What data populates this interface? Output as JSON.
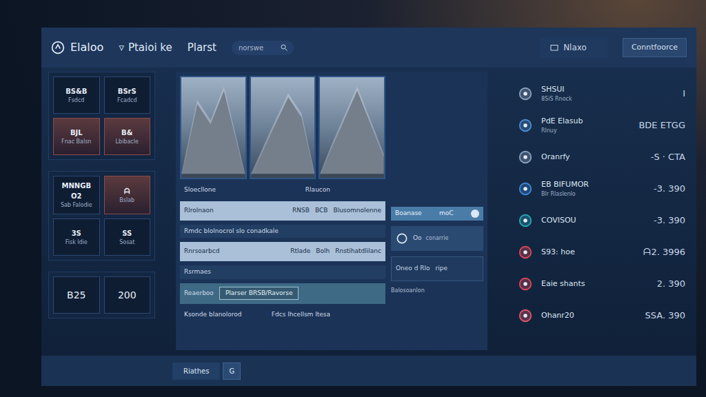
{
  "header": {
    "logo": "Elaloo",
    "menu_icon": "▿",
    "menu": "Ptaioi ke",
    "nav": "Plarst",
    "search": {
      "placeholder": "norswe"
    },
    "user": "Nlaxo",
    "action": "Conntfoorce"
  },
  "sidebar": {
    "groups": [
      {
        "tiles": [
          {
            "title": "BS&B",
            "sub": "Fsdcd",
            "highlighted": false
          },
          {
            "title": "BSrS",
            "sub": "Fcadcd",
            "highlighted": false
          },
          {
            "title": "BJL",
            "sub": "Fnac Balsn",
            "highlighted": true
          },
          {
            "title": "B&",
            "sub": "Lbibacle",
            "highlighted": true
          }
        ]
      },
      {
        "tiles": [
          {
            "title": "MNNGB O2",
            "sub": "Sab Falodie",
            "highlighted": false
          },
          {
            "title": "ᗩ",
            "sub": "Bslab",
            "highlighted": true
          },
          {
            "title": "3S",
            "sub": "Fisk ldie",
            "highlighted": false
          },
          {
            "title": "SS",
            "sub": "Sosat",
            "highlighted": false
          }
        ]
      }
    ],
    "totals": [
      "B25",
      "200"
    ]
  },
  "form": {
    "rows": [
      {
        "kind": "head",
        "cells": [
          "Sloecllone",
          "Rlaucon"
        ]
      },
      {
        "kind": "field",
        "cells": [
          "Rlrolnaon",
          "RNSB",
          "BCB",
          "Blusomnolenne"
        ]
      },
      {
        "kind": "label",
        "cells": [
          "Rmdc blolnocrol slo conadkale"
        ]
      },
      {
        "kind": "field",
        "cells": [
          "Rnrsoarbcd",
          "Rtlade",
          "Bolh",
          "Rnstihatdlilanc"
        ]
      },
      {
        "kind": "label",
        "cells": [
          "Rsrmaes"
        ]
      },
      {
        "kind": "input",
        "cells": [
          "Reaerboo",
          "Plarser BRSB/Ravorse"
        ]
      },
      {
        "kind": "foot",
        "cells": [
          "Ksonde blanolorod",
          "Fdcs lhcellsm ltesa"
        ]
      }
    ]
  },
  "side": {
    "toggle": {
      "label": "Boanase",
      "value": "moC",
      "on": true
    },
    "card": {
      "label": "Oo",
      "sub": "conarrie"
    },
    "card2": [
      "Oneo d Rlo",
      "ripe"
    ],
    "foot": "Balosoanlon"
  },
  "list": [
    {
      "name": "SHSUI",
      "sub": "8SiS Rnock",
      "value": "I",
      "color": "#8aa0bb"
    },
    {
      "name": "PdE Elasub",
      "sub": "Rlnuy",
      "value": "BDE ETGG",
      "color": "#4a8cd0"
    },
    {
      "name": "Oranrfy",
      "sub": "",
      "value": "-S · CTA",
      "color": "#8aa0bb"
    },
    {
      "name": "EB BIFUMOR",
      "sub": "Blr Rlaslenlo",
      "value": "-3. 390",
      "color": "#3d86d6"
    },
    {
      "name": "COVISOU",
      "sub": "",
      "value": "-3. 390",
      "color": "#2aa6b8"
    },
    {
      "name": "S93: hoe",
      "sub": "",
      "value": "ᗩ2. 3996",
      "color": "#d9485a"
    },
    {
      "name": "Eaie shants",
      "sub": "",
      "value": "2. 390",
      "color": "#d9485a"
    },
    {
      "name": "Ohanr20",
      "sub": "",
      "value": "SSA. 390",
      "color": "#e0566a"
    }
  ],
  "bottom": {
    "label": "Riathes",
    "button": "G"
  }
}
